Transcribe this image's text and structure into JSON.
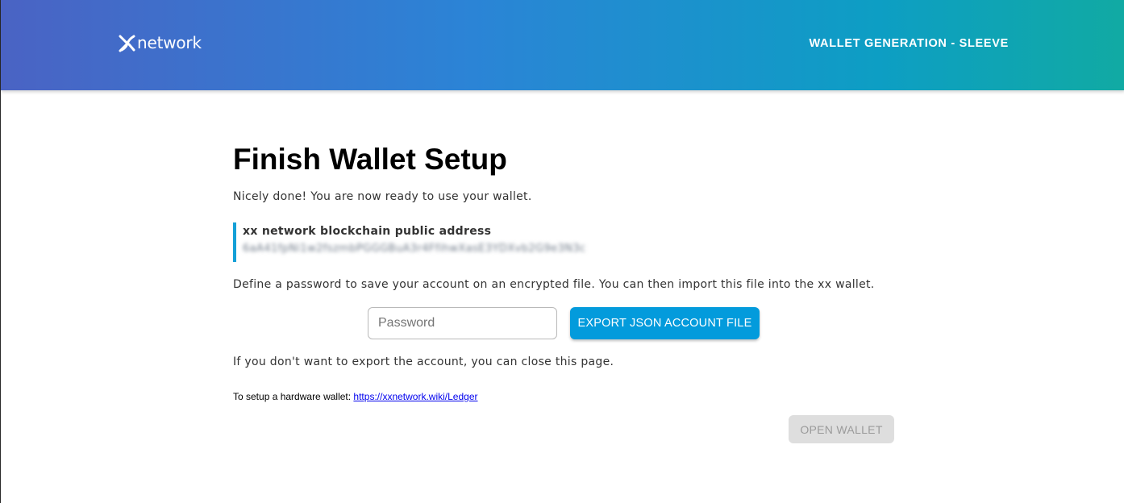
{
  "header": {
    "logo_text": "network",
    "title": "WALLET GENERATION - SLEEVE"
  },
  "main": {
    "title": "Finish Wallet Setup",
    "intro": "Nicely done! You are now ready to use your wallet.",
    "address": {
      "label": "xx network blockchain public address",
      "value": "6aA41fpNi1w2fszmbPGGGBuA3r4FfihwXasE3YDXvb2G9e3N3c"
    },
    "define_text": "Define a password to save your account on an encrypted file. You can then import this file into the xx wallet.",
    "password_placeholder": "Password",
    "export_button": "EXPORT JSON ACCOUNT FILE",
    "close_text": "If you don't want to export the account, you can close this page.",
    "hardware": {
      "prefix": "To setup a hardware wallet: ",
      "link_text": "https://xxnetwork.wiki/Ledger"
    },
    "open_wallet_button": "OPEN WALLET"
  },
  "colors": {
    "accent": "#039bdc",
    "address_bar": "#14a0d7",
    "header_gradient": [
      "#4a63c4",
      "#2b84d6",
      "#0d9ec4",
      "#11aaa3"
    ]
  }
}
